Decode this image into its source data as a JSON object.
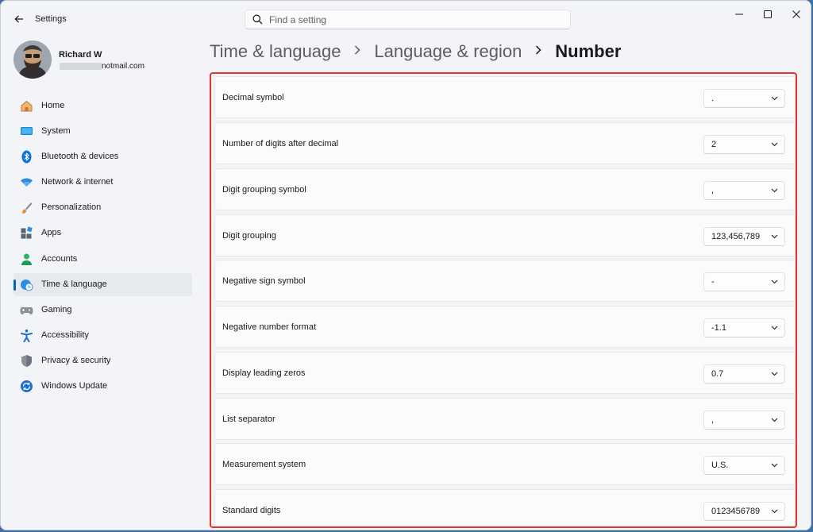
{
  "window": {
    "app_title": "Settings",
    "search_placeholder": "Find a setting"
  },
  "profile": {
    "name": "Richard W",
    "email_visible": "notmail.com"
  },
  "sidebar": {
    "items": [
      {
        "label": "Home",
        "icon": "home-icon",
        "active": false
      },
      {
        "label": "System",
        "icon": "system-icon",
        "active": false
      },
      {
        "label": "Bluetooth & devices",
        "icon": "bluetooth-icon",
        "active": false
      },
      {
        "label": "Network & internet",
        "icon": "wifi-icon",
        "active": false
      },
      {
        "label": "Personalization",
        "icon": "brush-icon",
        "active": false
      },
      {
        "label": "Apps",
        "icon": "apps-icon",
        "active": false
      },
      {
        "label": "Accounts",
        "icon": "accounts-icon",
        "active": false
      },
      {
        "label": "Time & language",
        "icon": "globe-clock-icon",
        "active": true
      },
      {
        "label": "Gaming",
        "icon": "gamepad-icon",
        "active": false
      },
      {
        "label": "Accessibility",
        "icon": "accessibility-icon",
        "active": false
      },
      {
        "label": "Privacy & security",
        "icon": "shield-icon",
        "active": false
      },
      {
        "label": "Windows Update",
        "icon": "update-icon",
        "active": false
      }
    ]
  },
  "breadcrumb": {
    "parts": [
      "Time & language",
      "Language & region"
    ],
    "current": "Number"
  },
  "settings": [
    {
      "label": "Decimal symbol",
      "value": "."
    },
    {
      "label": "Number of digits after decimal",
      "value": "2"
    },
    {
      "label": "Digit grouping symbol",
      "value": ","
    },
    {
      "label": "Digit grouping",
      "value": "123,456,789"
    },
    {
      "label": "Negative sign symbol",
      "value": "-"
    },
    {
      "label": "Negative number format",
      "value": "-1.1"
    },
    {
      "label": "Display leading zeros",
      "value": "0.7"
    },
    {
      "label": "List separator",
      "value": ","
    },
    {
      "label": "Measurement system",
      "value": "U.S."
    },
    {
      "label": "Standard digits",
      "value": "0123456789"
    }
  ],
  "colors": {
    "accent": "#0067c0",
    "highlight_frame": "#e2352c"
  }
}
